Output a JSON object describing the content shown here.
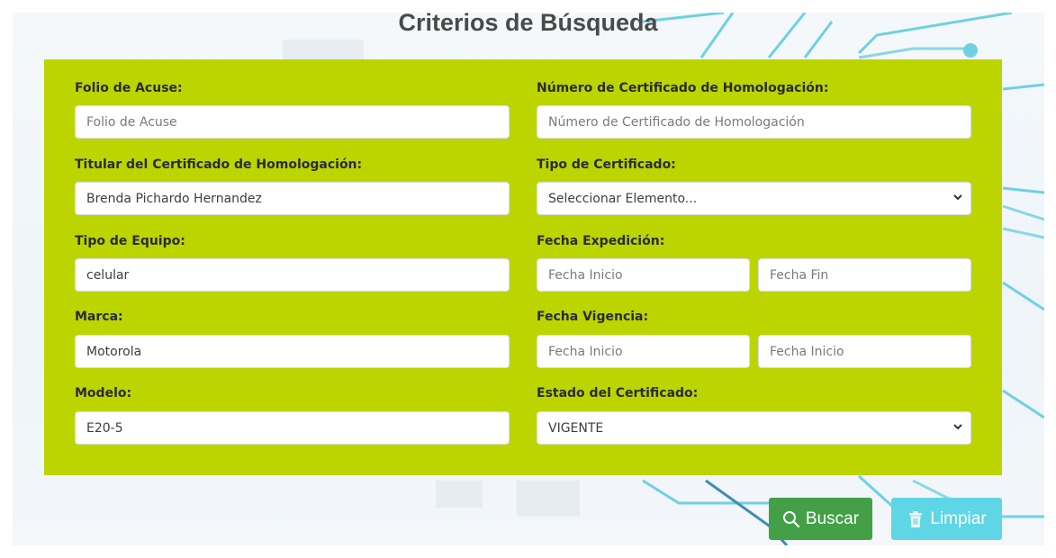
{
  "title": "Criterios de Búsqueda",
  "fields": {
    "folio": {
      "label": "Folio de Acuse:",
      "value": "",
      "placeholder": "Folio de Acuse"
    },
    "certificado_num": {
      "label": "Número de Certificado de Homologación:",
      "value": "",
      "placeholder": "Número de Certificado de Homologación"
    },
    "titular": {
      "label": "Titular del Certificado de Homologación:",
      "value": "Brenda Pichardo Hernandez",
      "placeholder": ""
    },
    "tipo_certificado": {
      "label": "Tipo de Certificado:",
      "selected": "Seleccionar Elemento..."
    },
    "tipo_equipo": {
      "label": "Tipo de Equipo:",
      "value": "celular",
      "placeholder": ""
    },
    "fecha_expedicion": {
      "label": "Fecha Expedición:",
      "start_placeholder": "Fecha Inicio",
      "end_placeholder": "Fecha Fin"
    },
    "marca": {
      "label": "Marca:",
      "value": "Motorola",
      "placeholder": ""
    },
    "fecha_vigencia": {
      "label": "Fecha Vigencia:",
      "start_placeholder": "Fecha Inicio",
      "end_placeholder": "Fecha Inicio"
    },
    "modelo": {
      "label": "Modelo:",
      "value": "E20-5",
      "placeholder": ""
    },
    "estado_certificado": {
      "label": "Estado del Certificado:",
      "selected": "VIGENTE"
    }
  },
  "buttons": {
    "search_label": "Buscar",
    "clear_label": "Limpiar",
    "search_icon": "search-icon",
    "clear_icon": "trash-icon"
  },
  "colors": {
    "panel": "#bcd500",
    "search_button": "#43a047",
    "clear_button": "#5fd6e6"
  }
}
